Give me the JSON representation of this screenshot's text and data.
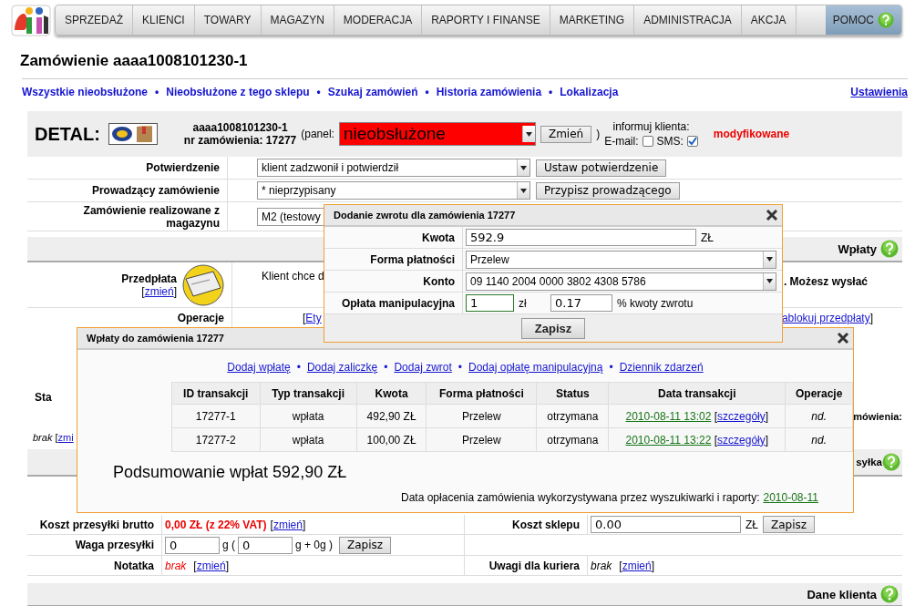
{
  "nav": {
    "items": [
      {
        "label": "SPRZEDAŻ",
        "kind": "menu"
      },
      {
        "label": "KLIENCI",
        "kind": "menu"
      },
      {
        "label": "TOWARY",
        "kind": "menu"
      },
      {
        "label": "MAGAZYN",
        "kind": "menu"
      },
      {
        "label": "MODERACJA",
        "kind": "menu"
      },
      {
        "label": "RAPORTY I FINANSE",
        "kind": "menu"
      },
      {
        "label": "MARKETING",
        "kind": "menu"
      },
      {
        "label": "ADMINISTRACJA",
        "kind": "menu"
      },
      {
        "label": "AKCJA",
        "kind": "menu"
      },
      {
        "label": "POMOC",
        "kind": "help"
      }
    ]
  },
  "page_title": "Zamówienie aaaa1008101230-1",
  "links": {
    "items": [
      "Wszystkie nieobsłużone",
      "Nieobsłużone z tego sklepu",
      "Szukaj zamówień",
      "Historia zamówienia",
      "Lokalizacja"
    ],
    "separator": "•",
    "settings": "Ustawienia"
  },
  "detail": {
    "label": "DETAL:",
    "order_code": "aaaa1008101230-1",
    "order_number": "nr zamówienia: 17277",
    "panel_open": "(panel:",
    "status": "nieobsłużone",
    "change_button": "Zmień",
    "panel_close": ")",
    "notify_label": "informuj klienta:",
    "email_label": "E-mail:",
    "email_checked": false,
    "sms_label": "SMS:",
    "sms_checked": true,
    "modified": "modyfikowane"
  },
  "form_rows": [
    {
      "label": "Potwierdzenie",
      "value": "klient zadzwonił i potwierdził",
      "button": "Ustaw potwierdzenie"
    },
    {
      "label": "Prowadzący zamówienie",
      "value": "* nieprzypisany",
      "button": "Przypisz prowadzącego"
    },
    {
      "label": "Zamówienie realizowane z magazynu",
      "value": "M2 (testowy"
    }
  ],
  "payments_section": {
    "title": "Wpłaty",
    "prepayment_label": "Przedpłata",
    "prepayment_link": {
      "open": "[",
      "link": "zmień",
      "close": "]"
    },
    "client_text": "Klient chce d",
    "note": ". Możesz wysłać",
    "operations_label": "Operacje",
    "operations_left": {
      "open": "[",
      "link": "Ety"
    },
    "operations_right": {
      "link": "ablokuj przedpłaty",
      "close": "]"
    },
    "status_fragment": "Sta",
    "order_fragment": "mówienia:",
    "note_fragment": {
      "text": "brak",
      "open": "[",
      "link": "zmi"
    }
  },
  "shipping_section": {
    "title": "syłka",
    "rows": [
      {
        "label": "Koszt przesyłki brutto",
        "value": "0,00 ZŁ (z 22% VAT)",
        "link": {
          "open": "[",
          "link": "zmień",
          "close": "]"
        },
        "label2": "Koszt sklepu",
        "input2": "0.00",
        "unit2": "ZŁ",
        "button2": "Zapisz"
      },
      {
        "label": "Waga przesyłki",
        "input_a": "0",
        "unit_a": "g (",
        "input_b": "0",
        "unit_b": "g + 0g )",
        "button": "Zapisz"
      },
      {
        "label": "Notatka",
        "value": "brak",
        "link": {
          "open": "[",
          "link": "zmień",
          "close": "]"
        },
        "label2": "Uwagi dla kuriera",
        "value2": "brak",
        "link2": {
          "open": "[",
          "link": "zmień",
          "close": "]"
        }
      }
    ]
  },
  "customer_section": {
    "title": "Dane klienta"
  },
  "refund_dialog": {
    "title": "Dodanie zwrotu dla zamówienia 17277",
    "fields": [
      {
        "kind": "input",
        "label": "Kwota",
        "value": "592.9",
        "unit": "ZŁ"
      },
      {
        "kind": "select",
        "label": "Forma płatności",
        "value": "Przelew"
      },
      {
        "kind": "select",
        "label": "Konto",
        "value": "09 1140 2004 0000 3802 4308 5786"
      },
      {
        "kind": "fee",
        "label": "Opłata manipulacyjna",
        "value": "1",
        "unit": "zł",
        "percent": "0.17",
        "percent_unit": "% kwoty zwrotu"
      }
    ],
    "button": "Zapisz"
  },
  "payments_dialog": {
    "title": "Wpłaty do zamówienia 17277",
    "links": [
      "Dodaj wpłatę",
      "Dodaj zaliczkę",
      "Dodaj zwrot",
      "Dodaj opłatę manipulacyjną",
      "Dziennik zdarzeń"
    ],
    "separator": "•",
    "columns": [
      "ID transakcji",
      "Typ transakcji",
      "Kwota",
      "Forma płatności",
      "Status",
      "Data transakcji",
      "Operacje"
    ],
    "rows": [
      {
        "id": "17277-1",
        "type": "wpłata",
        "amount": "492,90 ZŁ",
        "method": "Przelew",
        "status": "otrzymana",
        "date": "2010-08-11 13:02",
        "details": {
          "open": "[",
          "link": "szczegóły",
          "close": "]"
        },
        "operations": "nd."
      },
      {
        "id": "17277-2",
        "type": "wpłata",
        "amount": "100,00 ZŁ",
        "method": "Przelew",
        "status": "otrzymana",
        "date": "2010-08-11 13:22",
        "details": {
          "open": "[",
          "link": "szczegóły",
          "close": "]"
        },
        "operations": "nd."
      }
    ],
    "summary": "Podsumowanie wpłat 592,90 ZŁ",
    "footer_text": "Data opłacenia zamówienia wykorzystywana przez wyszukiwarki i raporty:",
    "footer_date": "2010-08-11"
  }
}
